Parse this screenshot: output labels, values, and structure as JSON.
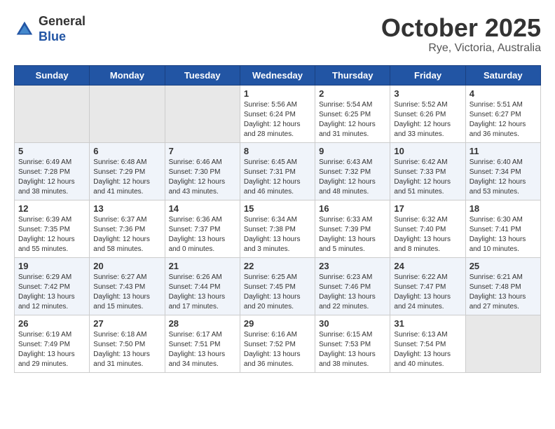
{
  "header": {
    "logo_line1": "General",
    "logo_line2": "Blue",
    "month": "October 2025",
    "location": "Rye, Victoria, Australia"
  },
  "weekdays": [
    "Sunday",
    "Monday",
    "Tuesday",
    "Wednesday",
    "Thursday",
    "Friday",
    "Saturday"
  ],
  "weeks": [
    [
      {
        "day": "",
        "info": ""
      },
      {
        "day": "",
        "info": ""
      },
      {
        "day": "",
        "info": ""
      },
      {
        "day": "1",
        "info": "Sunrise: 5:56 AM\nSunset: 6:24 PM\nDaylight: 12 hours\nand 28 minutes."
      },
      {
        "day": "2",
        "info": "Sunrise: 5:54 AM\nSunset: 6:25 PM\nDaylight: 12 hours\nand 31 minutes."
      },
      {
        "day": "3",
        "info": "Sunrise: 5:52 AM\nSunset: 6:26 PM\nDaylight: 12 hours\nand 33 minutes."
      },
      {
        "day": "4",
        "info": "Sunrise: 5:51 AM\nSunset: 6:27 PM\nDaylight: 12 hours\nand 36 minutes."
      }
    ],
    [
      {
        "day": "5",
        "info": "Sunrise: 6:49 AM\nSunset: 7:28 PM\nDaylight: 12 hours\nand 38 minutes."
      },
      {
        "day": "6",
        "info": "Sunrise: 6:48 AM\nSunset: 7:29 PM\nDaylight: 12 hours\nand 41 minutes."
      },
      {
        "day": "7",
        "info": "Sunrise: 6:46 AM\nSunset: 7:30 PM\nDaylight: 12 hours\nand 43 minutes."
      },
      {
        "day": "8",
        "info": "Sunrise: 6:45 AM\nSunset: 7:31 PM\nDaylight: 12 hours\nand 46 minutes."
      },
      {
        "day": "9",
        "info": "Sunrise: 6:43 AM\nSunset: 7:32 PM\nDaylight: 12 hours\nand 48 minutes."
      },
      {
        "day": "10",
        "info": "Sunrise: 6:42 AM\nSunset: 7:33 PM\nDaylight: 12 hours\nand 51 minutes."
      },
      {
        "day": "11",
        "info": "Sunrise: 6:40 AM\nSunset: 7:34 PM\nDaylight: 12 hours\nand 53 minutes."
      }
    ],
    [
      {
        "day": "12",
        "info": "Sunrise: 6:39 AM\nSunset: 7:35 PM\nDaylight: 12 hours\nand 55 minutes."
      },
      {
        "day": "13",
        "info": "Sunrise: 6:37 AM\nSunset: 7:36 PM\nDaylight: 12 hours\nand 58 minutes."
      },
      {
        "day": "14",
        "info": "Sunrise: 6:36 AM\nSunset: 7:37 PM\nDaylight: 13 hours\nand 0 minutes."
      },
      {
        "day": "15",
        "info": "Sunrise: 6:34 AM\nSunset: 7:38 PM\nDaylight: 13 hours\nand 3 minutes."
      },
      {
        "day": "16",
        "info": "Sunrise: 6:33 AM\nSunset: 7:39 PM\nDaylight: 13 hours\nand 5 minutes."
      },
      {
        "day": "17",
        "info": "Sunrise: 6:32 AM\nSunset: 7:40 PM\nDaylight: 13 hours\nand 8 minutes."
      },
      {
        "day": "18",
        "info": "Sunrise: 6:30 AM\nSunset: 7:41 PM\nDaylight: 13 hours\nand 10 minutes."
      }
    ],
    [
      {
        "day": "19",
        "info": "Sunrise: 6:29 AM\nSunset: 7:42 PM\nDaylight: 13 hours\nand 12 minutes."
      },
      {
        "day": "20",
        "info": "Sunrise: 6:27 AM\nSunset: 7:43 PM\nDaylight: 13 hours\nand 15 minutes."
      },
      {
        "day": "21",
        "info": "Sunrise: 6:26 AM\nSunset: 7:44 PM\nDaylight: 13 hours\nand 17 minutes."
      },
      {
        "day": "22",
        "info": "Sunrise: 6:25 AM\nSunset: 7:45 PM\nDaylight: 13 hours\nand 20 minutes."
      },
      {
        "day": "23",
        "info": "Sunrise: 6:23 AM\nSunset: 7:46 PM\nDaylight: 13 hours\nand 22 minutes."
      },
      {
        "day": "24",
        "info": "Sunrise: 6:22 AM\nSunset: 7:47 PM\nDaylight: 13 hours\nand 24 minutes."
      },
      {
        "day": "25",
        "info": "Sunrise: 6:21 AM\nSunset: 7:48 PM\nDaylight: 13 hours\nand 27 minutes."
      }
    ],
    [
      {
        "day": "26",
        "info": "Sunrise: 6:19 AM\nSunset: 7:49 PM\nDaylight: 13 hours\nand 29 minutes."
      },
      {
        "day": "27",
        "info": "Sunrise: 6:18 AM\nSunset: 7:50 PM\nDaylight: 13 hours\nand 31 minutes."
      },
      {
        "day": "28",
        "info": "Sunrise: 6:17 AM\nSunset: 7:51 PM\nDaylight: 13 hours\nand 34 minutes."
      },
      {
        "day": "29",
        "info": "Sunrise: 6:16 AM\nSunset: 7:52 PM\nDaylight: 13 hours\nand 36 minutes."
      },
      {
        "day": "30",
        "info": "Sunrise: 6:15 AM\nSunset: 7:53 PM\nDaylight: 13 hours\nand 38 minutes."
      },
      {
        "day": "31",
        "info": "Sunrise: 6:13 AM\nSunset: 7:54 PM\nDaylight: 13 hours\nand 40 minutes."
      },
      {
        "day": "",
        "info": ""
      }
    ]
  ]
}
